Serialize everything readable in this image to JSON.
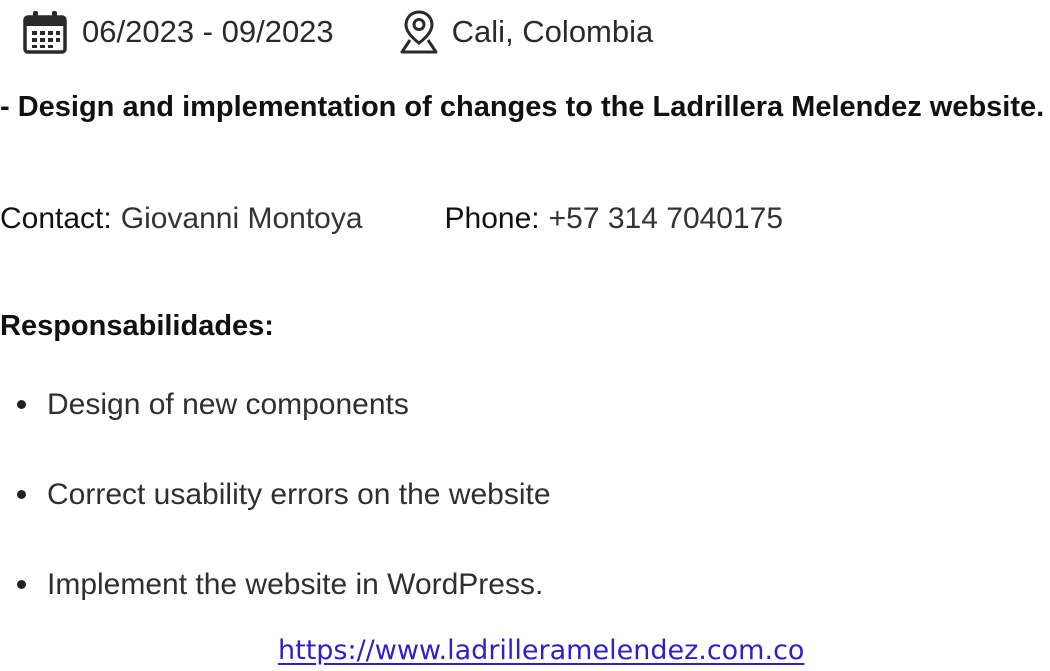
{
  "meta": {
    "calendar_icon": "calendar-icon",
    "dates": "06/2023 - 09/2023",
    "location_icon": "location-pin-icon",
    "location": "Cali, Colombia"
  },
  "headline": "- Design and implementation of changes to the Ladrillera Melendez website.",
  "contact": {
    "contact_label": "Contact:",
    "contact_name": "Giovanni Montoya",
    "phone_label": "Phone:",
    "phone_number": "+57 314 7040175"
  },
  "responsibilities": {
    "title": "Responsabilidades:",
    "items": [
      "Design of new components",
      "Correct usability errors on the website",
      "Implement the website in WordPress."
    ]
  },
  "link": {
    "text": "https://www.ladrilleramelendez.com.co"
  },
  "colors": {
    "link": "#2f21c9",
    "text": "#141414"
  }
}
